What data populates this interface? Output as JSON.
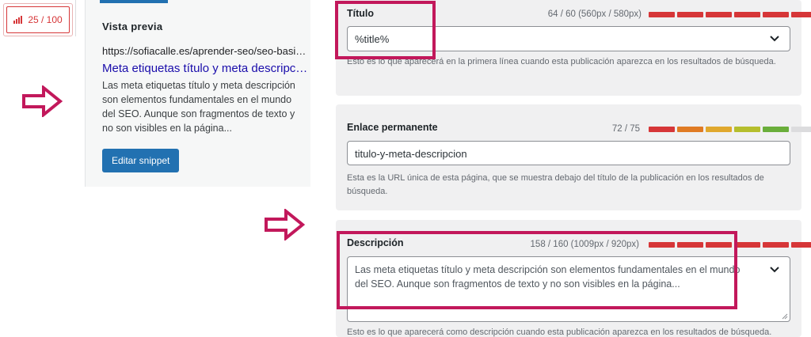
{
  "score": {
    "value": "25 / 100"
  },
  "preview": {
    "heading": "Vista previa",
    "url": "https://sofiacalle.es/aprender-seo/seo-basico/meta-etiquetas",
    "title": "Meta etiquetas título y meta descripción",
    "description": "Las meta etiquetas título y meta descripción son elementos fundamentales en el mundo del SEO. Aunque son fragmentos de texto y no son visibles en la página...",
    "edit_button": "Editar snippet"
  },
  "titulo": {
    "label": "Título",
    "count": "64 / 60 (560px / 580px)",
    "value": "%title%",
    "help": "Esto es lo que aparecerá en la primera línea cuando esta publicación aparezca en los resultados de búsqueda.",
    "bar_colors": [
      "#d63638",
      "#d63638",
      "#d63638",
      "#d63638",
      "#d63638",
      "#d63638"
    ]
  },
  "enlace": {
    "label": "Enlace permanente",
    "count": "72 / 75",
    "value": "titulo-y-meta-descripcion",
    "help": "Esta es la URL única de esta página, que se muestra debajo del título de la publicación en los resultados de búsqueda.",
    "bar_colors": [
      "#d63638",
      "#e07b24",
      "#e0a82e",
      "#b5be2d",
      "#6aae3b",
      "#dcdcde"
    ]
  },
  "descripcion": {
    "label": "Descripción",
    "count": "158 / 160 (1009px / 920px)",
    "value": "Las meta etiquetas título y meta descripción son elementos fundamentales en el mundo del SEO. Aunque son fragmentos de texto y no son visibles en la página...",
    "help": "Esto es lo que aparecerá como descripción cuando esta publicación aparezca en los resultados de búsqueda.",
    "bar_colors": [
      "#d63638",
      "#d63638",
      "#d63638",
      "#d63638",
      "#d63638",
      "#d63638"
    ]
  },
  "colors": {
    "accent": "#2271b1",
    "highlight": "#c2185b",
    "error": "#d63638"
  }
}
